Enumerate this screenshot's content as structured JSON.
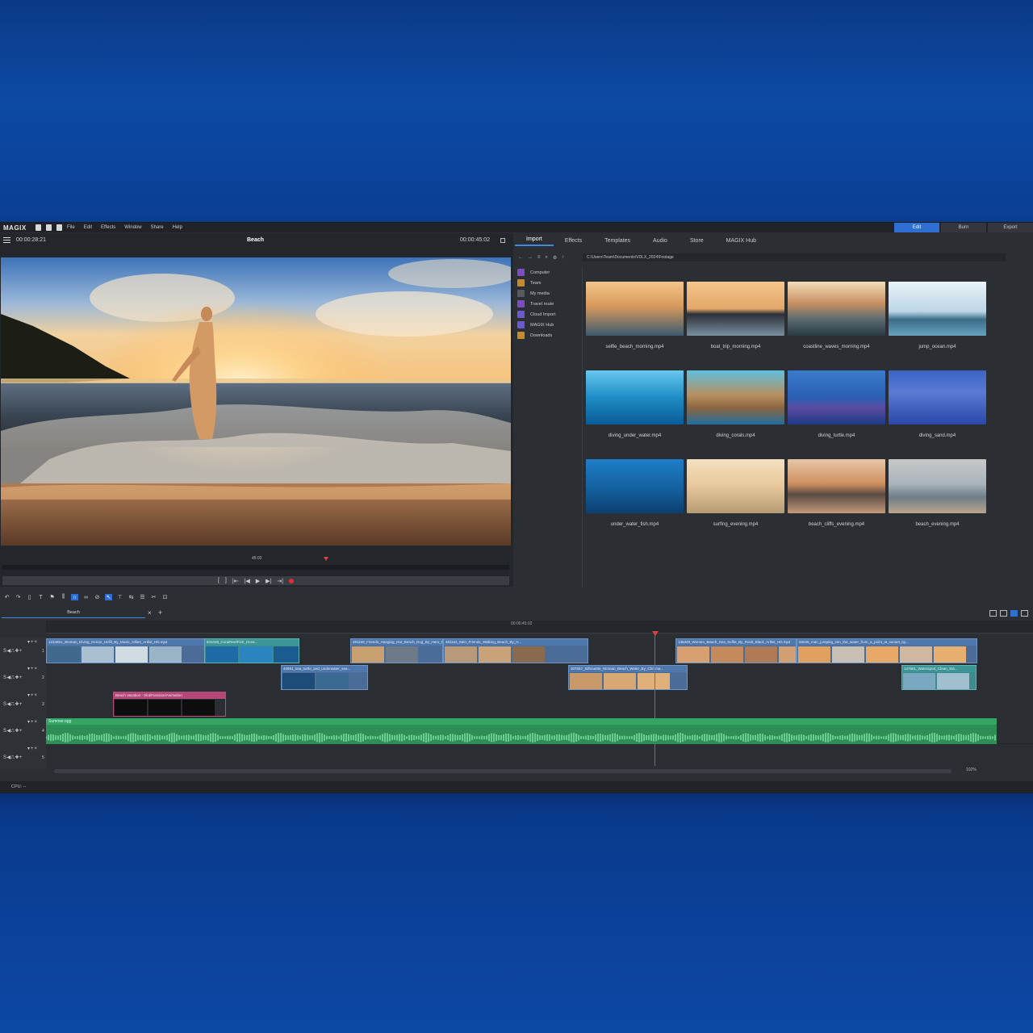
{
  "app": {
    "logo": "MAGIX",
    "menu": [
      "File",
      "Edit",
      "Effects",
      "Window",
      "Share",
      "Help"
    ],
    "modes": [
      "Edit",
      "Burn",
      "Export"
    ],
    "active_mode": "Edit"
  },
  "preview": {
    "time_left": "00:00:28:21",
    "title": "Beach",
    "time_right": "00:00:45:02",
    "scrub_label": "45:02"
  },
  "pool": {
    "tabs": [
      "Import",
      "Effects",
      "Templates",
      "Audio",
      "Store",
      "MAGIX Hub"
    ],
    "active_tab": "Import",
    "path": "C:\\Users\\Team\\Documents\\VDLX_2024\\Footage",
    "nav": [
      {
        "label": "Computer",
        "color": "#7d4dbf"
      },
      {
        "label": "Team",
        "color": "#c48a2c"
      },
      {
        "label": "My media",
        "color": "#555a60"
      },
      {
        "label": "Travel route",
        "color": "#7d4dbf"
      },
      {
        "label": "Cloud Import",
        "color": "#6a5ad0"
      },
      {
        "label": "MAGIX Hub",
        "color": "#6a5ad0"
      },
      {
        "label": "Downloads",
        "color": "#c48a2c"
      }
    ],
    "thumbnails": [
      {
        "name": "selfie_beach_morning.mp4",
        "bg": "linear-gradient(180deg,#f3c58a 0%,#d89a5c 45%,#3c5a6e 100%)"
      },
      {
        "name": "boat_trip_morning.mp4",
        "bg": "linear-gradient(180deg,#f6c68a 0%,#e3a66a 50%,#2c3038 60%,#7a8fa0 100%)"
      },
      {
        "name": "coastline_waves_morning.mp4",
        "bg": "linear-gradient(180deg,#f2dcb8 0%,#c89062 40%,#5a6a70 70%,#2a3a44 100%)"
      },
      {
        "name": "jump_ocean.mp4",
        "bg": "linear-gradient(180deg,#eaf3f8 0%,#bcd6e6 55%,#3c6c88 70%,#67a2bf 100%)"
      },
      {
        "name": "diving_under_water.mp4",
        "bg": "linear-gradient(180deg,#68c8ee 0%,#1e8cc4 50%,#0a5c98 100%)"
      },
      {
        "name": "diving_corals.mp4",
        "bg": "linear-gradient(180deg,#5ec0e0 0%,#b89060 45%,#8a6440 70%,#1e6fa0 100%)"
      },
      {
        "name": "diving_turtle.mp4",
        "bg": "linear-gradient(180deg,#3a7acc 0%,#2b5fb2 50%,#5a4aa0 70%,#1c3c86 100%)"
      },
      {
        "name": "diving_sand.mp4",
        "bg": "linear-gradient(180deg,#3b64c4 0%,#5a7ad4 40%,#2a48a8 100%)"
      },
      {
        "name": "under_water_fish.mp4",
        "bg": "linear-gradient(180deg,#1f7ec8 0%,#14609e 55%,#0b3f6e 100%)"
      },
      {
        "name": "surfing_evening.mp4",
        "bg": "linear-gradient(180deg,#f4e0c0 0%,#e8c89a 50%,#b49a74 100%)"
      },
      {
        "name": "beach_cliffs_evening.mp4",
        "bg": "linear-gradient(180deg,#e6c7a8 0%,#d09060 45%,#5a4a44 65%,#c29a7a 100%)"
      },
      {
        "name": "beach_evening.mp4",
        "bg": "linear-gradient(180deg,#c8c8c8 0%,#aab4bc 45%,#6e7e88 70%,#b8a48c 100%)"
      }
    ]
  },
  "timeline": {
    "project_tab": "Beach",
    "ruler_time": "00:00:45:02",
    "tracks": [
      {
        "number": "1",
        "clips": [
          {
            "label": "1234651_Woman_Diving_Ocean_Unfill_By_Music_Ollie4_Artlist_HD.mp4",
            "style": "blue",
            "frames": [
              "#3f6a8e",
              "#a9c0d2",
              "#d0dbe2",
              "#9ab4c8"
            ]
          },
          {
            "label": "831038_CoralReefFish_Ocea...",
            "style": "teal",
            "frames": [
              "#1d6aa4",
              "#2a84c0",
              "#1b5c90"
            ]
          },
          {
            "label": "481169_Friends_Hanging_Out_Beach_Dog_By_Hero_Film...",
            "style": "blue",
            "frames": [
              "#c8a070",
              "#6e7a88"
            ]
          },
          {
            "label": "481164_Men_Friends_Walking_Beach_By_H...",
            "style": "blue",
            "frames": [
              "#b89a7a",
              "#c9a27a",
              "#8a6a4e"
            ]
          },
          {
            "label": "136329_Women_Beach_Sea_Selfie_By_Ronit_Black_Artlist_HD.mp4",
            "style": "blue",
            "frames": [
              "#d8a070",
              "#c48a5c",
              "#b07a56",
              "#d0a072"
            ]
          },
          {
            "label": "65035_man_jumping_into_the_water_from_a_point_at_sunset_by...",
            "style": "blue",
            "frames": [
              "#e0a060",
              "#c8c0b4",
              "#e8a868",
              "#d0b8a0",
              "#e8b070"
            ]
          }
        ]
      },
      {
        "number": "2",
        "clips": [
          {
            "label": "40851_sea_turtle_and_underwater_sea...",
            "style": "blue",
            "frames": [
              "#1e4c78",
              "#3a6a92"
            ]
          },
          {
            "label": "307657_Silhouette_Woman_Beach_Water_By_Chroma...",
            "style": "blue",
            "frames": [
              "#c89a6a",
              "#d8a874",
              "#e0b07a"
            ]
          },
          {
            "label": "147681_Watersport_Clean_Wa...",
            "style": "teal",
            "frames": [
              "#7aa8c0",
              "#a0c0d0"
            ]
          }
        ]
      },
      {
        "number": "3",
        "clips": [
          {
            "label": "Beach Vacation - Slot/Function/Animation",
            "style": "pink",
            "frames": [
              "#0d0d0d",
              "#0d0d0d",
              "#0d0d0d"
            ]
          }
        ]
      },
      {
        "number": "4",
        "audio_label": "Summer.ogg"
      },
      {
        "number": "5",
        "clips": []
      }
    ],
    "zoom": "102%"
  },
  "status": {
    "cpu": "CPU: --"
  }
}
